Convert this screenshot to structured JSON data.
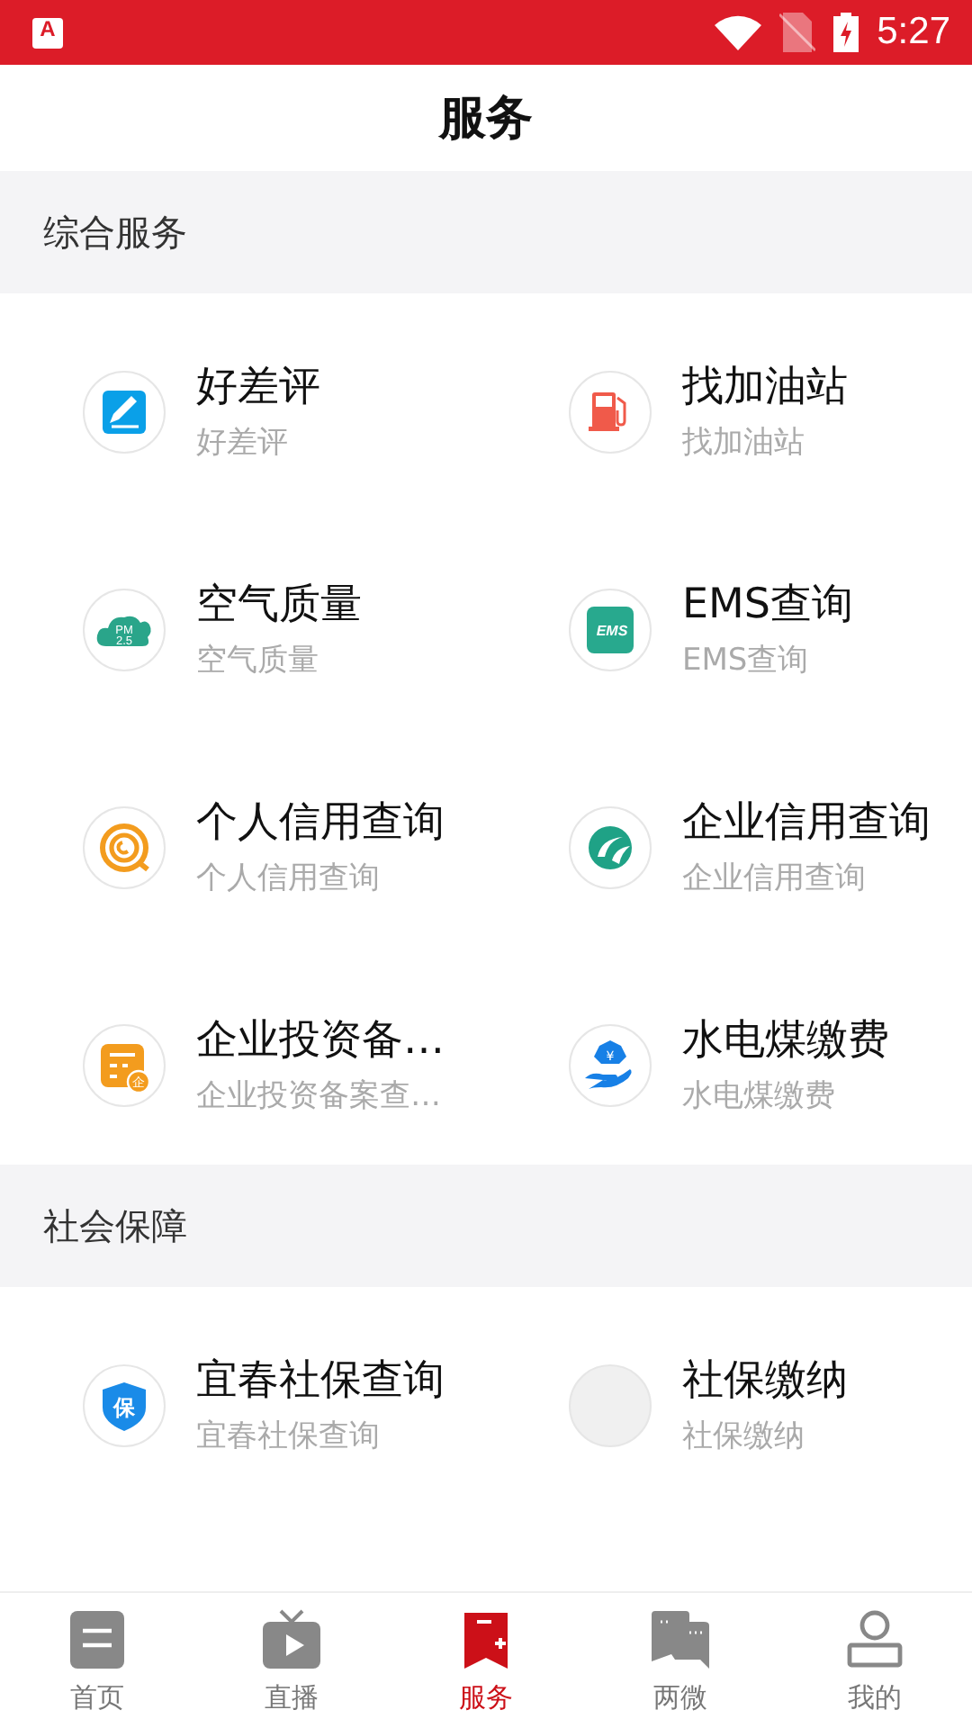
{
  "status_bar": {
    "notification_icon_text": "A",
    "time": "5:27"
  },
  "header": {
    "title": "服务"
  },
  "sections": [
    {
      "title": "综合服务",
      "items": [
        {
          "kind": "pen",
          "title": "好差评",
          "subtitle": "好差评"
        },
        {
          "kind": "fuel",
          "title": "找加油站",
          "subtitle": "找加油站"
        },
        {
          "kind": "pm",
          "icon_text": [
            "PM",
            "2.5"
          ],
          "title": "空气质量",
          "subtitle": "空气质量"
        },
        {
          "kind": "ems",
          "icon_text": [
            "EMS"
          ],
          "title": "EMS查询",
          "subtitle": "EMS查询"
        },
        {
          "kind": "credit",
          "title": "个人信用查询",
          "subtitle": "个人信用查询"
        },
        {
          "kind": "enterprise",
          "title": "企业信用查询",
          "subtitle": "企业信用查询"
        },
        {
          "kind": "invest",
          "icon_text": [
            "企"
          ],
          "title": "企业投资备…",
          "subtitle": "企业投资备案查…"
        },
        {
          "kind": "utility",
          "icon_text": [
            "¥"
          ],
          "title": "水电煤缴费",
          "subtitle": "水电煤缴费"
        }
      ]
    },
    {
      "title": "社会保障",
      "items": [
        {
          "kind": "shield",
          "icon_text": [
            "保"
          ],
          "title": "宜春社保查询",
          "subtitle": "宜春社保查询"
        },
        {
          "kind": "blank",
          "title": "社保缴纳",
          "subtitle": "社保缴纳"
        }
      ]
    }
  ],
  "tabs": [
    {
      "kind": "home",
      "label": "首页",
      "selected": false
    },
    {
      "kind": "tv",
      "label": "直播",
      "selected": false
    },
    {
      "kind": "service",
      "label": "服务",
      "selected": true
    },
    {
      "kind": "chat",
      "label": "两微",
      "selected": false
    },
    {
      "kind": "person",
      "label": "我的",
      "selected": false
    }
  ]
}
